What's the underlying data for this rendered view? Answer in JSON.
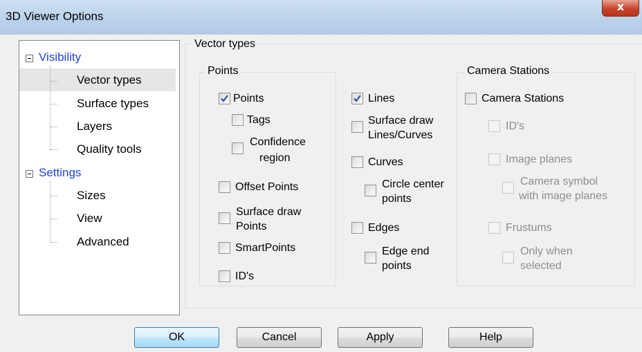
{
  "window": {
    "title": "3D Viewer Options",
    "close_glyph": "x"
  },
  "tree": {
    "categories": [
      {
        "label": "Visibility",
        "expander": "⊟",
        "items": [
          "Vector types",
          "Surface types",
          "Layers",
          "Quality tools"
        ]
      },
      {
        "label": "Settings",
        "expander": "⊟",
        "items": [
          "Sizes",
          "View",
          "Advanced"
        ]
      }
    ],
    "selected_item": "Vector types"
  },
  "panel": {
    "title": "Vector types",
    "points_group": {
      "title": "Points",
      "points": {
        "label": "Points",
        "checked": true
      },
      "tags": {
        "label": "Tags",
        "checked": false
      },
      "confidence": {
        "label_line1": "Confidence",
        "label_line2": "region",
        "checked": false
      },
      "offset_points": {
        "label": "Offset Points",
        "checked": false
      },
      "surface_draw_points": {
        "label_line1": "Surface draw",
        "label_line2": "Points",
        "checked": false
      },
      "smartpoints": {
        "label": "SmartPoints",
        "checked": false
      },
      "ids": {
        "label": "ID's",
        "checked": false
      }
    },
    "lines_column": {
      "lines": {
        "label": "Lines",
        "checked": true
      },
      "surface_draw_lines": {
        "label_line1": "Surface draw",
        "label_line2": "Lines/Curves",
        "checked": false
      },
      "curves": {
        "label": "Curves",
        "checked": false
      },
      "circle_center": {
        "label_line1": "Circle center",
        "label_line2": "points",
        "checked": false
      },
      "edges": {
        "label": "Edges",
        "checked": false
      },
      "edge_end": {
        "label_line1": "Edge end",
        "label_line2": "points",
        "checked": false
      }
    },
    "camera_group": {
      "title": "Camera Stations",
      "camera_stations": {
        "label": "Camera Stations",
        "checked": false
      },
      "ids": {
        "label": "ID's",
        "checked": false,
        "disabled": true
      },
      "image_planes": {
        "label": "Image planes",
        "checked": false,
        "disabled": true
      },
      "camera_symbol": {
        "label_line1": "Camera symbol",
        "label_line2": "with image planes",
        "checked": false,
        "disabled": true
      },
      "frustums": {
        "label": "Frustums",
        "checked": false,
        "disabled": true
      },
      "only_selected": {
        "label_line1": "Only when",
        "label_line2": "selected",
        "checked": false,
        "disabled": true
      }
    }
  },
  "buttons": {
    "ok": "OK",
    "cancel": "Cancel",
    "apply": "Apply",
    "help": "Help"
  },
  "colors": {
    "tree_category": "#1e3fd6",
    "disabled_text": "#8d8d8d",
    "check_mark": "#2b4fa0"
  }
}
